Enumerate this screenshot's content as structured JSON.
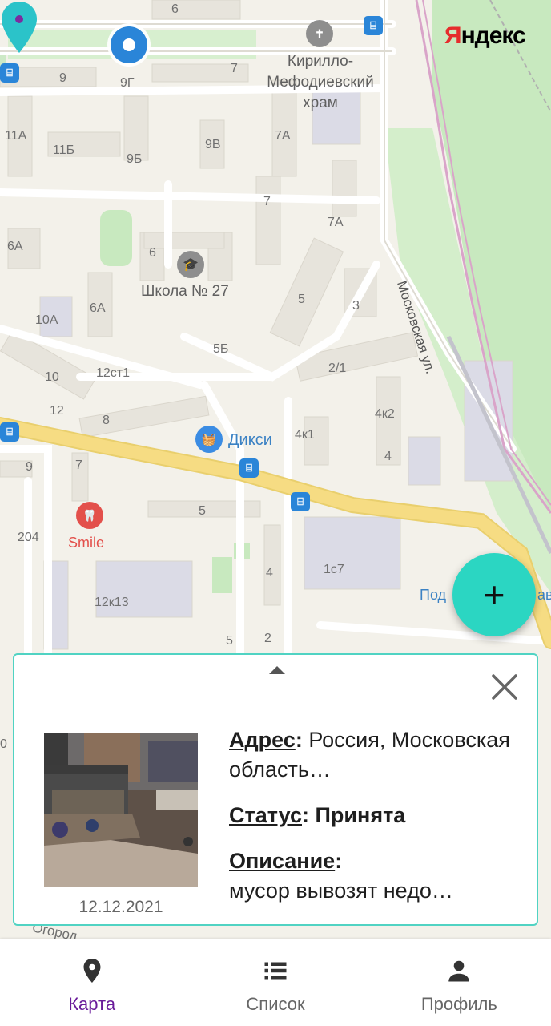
{
  "map": {
    "logo": "Яндекс",
    "labels": {
      "n6_top": "6",
      "n9": "9",
      "n9g": "9Г",
      "n7_top": "7",
      "n11a": "11А",
      "n11b": "11Б",
      "n9b": "9Б",
      "n9v": "9В",
      "n7a_top": "7А",
      "n7_mid": "7",
      "n7a_mid": "7А",
      "n6a": "6А",
      "n6": "6",
      "n6a2": "6А",
      "n5": "5",
      "n3": "3",
      "n10a": "10А",
      "n5b": "5Б",
      "n2_1": "2/1",
      "n10": "10",
      "n12st1": "12ст1",
      "n12": "12",
      "n8": "8",
      "n4k2": "4к2",
      "n4k1": "4к1",
      "n4": "4",
      "n9_left": "9",
      "n7_left": "7",
      "n5_low": "5",
      "n204": "204",
      "n4_low": "4",
      "n1s7": "1с7",
      "n12k13": "12к13",
      "n5_bottom": "5",
      "n2_bottom": "2",
      "n0": "0",
      "ogorod": "Огород"
    },
    "poi": {
      "church": "Кирилло-\nМефодиевский\nхрам",
      "school": "Школа № 27",
      "shop": "Дикси",
      "dental": "Smile",
      "cut": "Под",
      "cut_right": "ав"
    },
    "street": "Московская ул."
  },
  "fab_label": "+",
  "card": {
    "photo_date": "12.12.2021",
    "address_label": "Адрес",
    "address_value": "Россия, Московская область…",
    "status_label": "Статус",
    "status_value": "Принята",
    "description_label": "Описание",
    "description_value": "мусор вывозят недо…"
  },
  "nav": {
    "items": [
      {
        "label": "Карта",
        "icon": "map-pin-icon",
        "active": true
      },
      {
        "label": "Список",
        "icon": "list-icon",
        "active": false
      },
      {
        "label": "Профиль",
        "icon": "person-icon",
        "active": false
      }
    ]
  },
  "colors": {
    "accent": "#2bd6c2",
    "active_nav": "#6a1b9a",
    "map_bg": "#f3f1ea",
    "road_yellow": "#f6dc83",
    "bus_blue": "#2a85d8"
  }
}
